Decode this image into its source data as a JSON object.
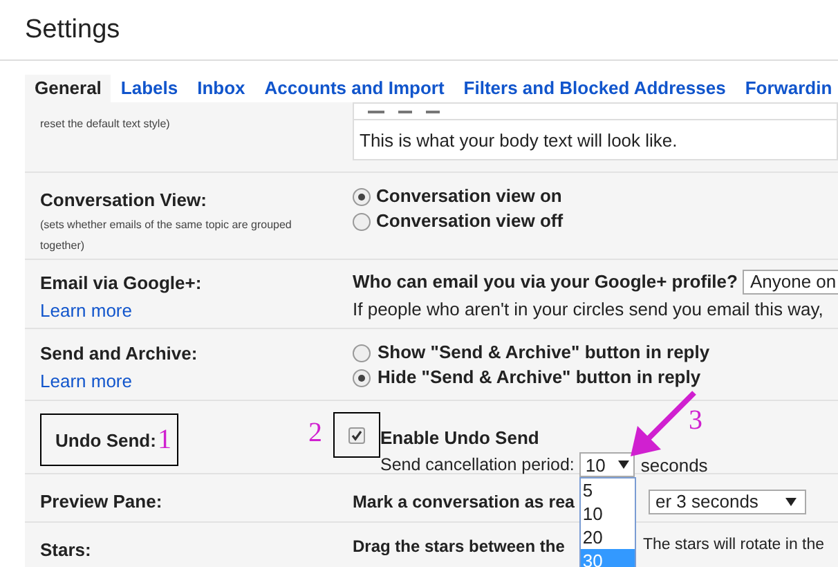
{
  "title": "Settings",
  "tabs": [
    {
      "label": "General",
      "selected": true
    },
    {
      "label": "Labels",
      "selected": false
    },
    {
      "label": "Inbox",
      "selected": false
    },
    {
      "label": "Accounts and Import",
      "selected": false
    },
    {
      "label": "Filters and Blocked Addresses",
      "selected": false
    },
    {
      "label": "Forwardin",
      "selected": false
    }
  ],
  "default_text": {
    "hint": "reset the default text style)",
    "preview": "This is what your body text will look like."
  },
  "conversation_view": {
    "label": "Conversation View:",
    "hint": "(sets whether emails of the same topic are grouped together)",
    "options": [
      {
        "label": "Conversation view on",
        "selected": true
      },
      {
        "label": "Conversation view off",
        "selected": false
      }
    ]
  },
  "email_via_google": {
    "label": "Email via Google+:",
    "link": "Learn more",
    "question": "Who can email you via your Google+ profile?",
    "select_value": "Anyone on",
    "note": "If people who aren't in your circles send you email this way,"
  },
  "send_and_archive": {
    "label": "Send and Archive:",
    "link": "Learn more",
    "options": [
      {
        "label": "Show \"Send & Archive\" button in reply",
        "selected": false
      },
      {
        "label": "Hide \"Send & Archive\" button in reply",
        "selected": true
      }
    ]
  },
  "undo_send": {
    "label": "Undo Send:",
    "checkbox_label": "Enable Undo Send",
    "checked": true,
    "period_label": "Send cancellation period:",
    "period_value": "10",
    "unit": "seconds",
    "dropdown_options": [
      {
        "label": "5",
        "selected": false
      },
      {
        "label": "10",
        "selected": false
      },
      {
        "label": "20",
        "selected": false
      },
      {
        "label": "30",
        "selected": true
      }
    ]
  },
  "preview_pane": {
    "label": "Preview Pane:",
    "text": "Mark a conversation as rea",
    "select_value": "er 3 seconds"
  },
  "stars": {
    "label": "Stars:",
    "text": "Drag the stars between the",
    "text_2": "The stars will rotate in the"
  },
  "annotations": [
    "1",
    "2",
    "3"
  ]
}
